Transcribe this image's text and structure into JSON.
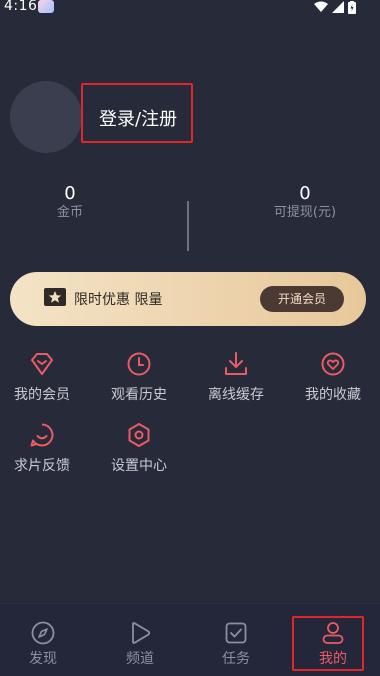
{
  "status_bar": {
    "time": "4:16"
  },
  "profile": {
    "login_label": "登录/注册"
  },
  "stats": [
    {
      "value": "0",
      "label": "金币"
    },
    {
      "value": "0",
      "label": "可提现(元)"
    }
  ],
  "vip_banner": {
    "text": "限时优惠 限量",
    "button_label": "开通会员"
  },
  "menu": {
    "items": [
      {
        "label": "我的会员",
        "icon": "diamond-icon"
      },
      {
        "label": "观看历史",
        "icon": "clock-icon"
      },
      {
        "label": "离线缓存",
        "icon": "download-icon"
      },
      {
        "label": "我的收藏",
        "icon": "heart-icon"
      },
      {
        "label": "求片反馈",
        "icon": "chat-smile-icon"
      },
      {
        "label": "设置中心",
        "icon": "settings-hex-icon"
      }
    ]
  },
  "bottom_nav": {
    "items": [
      {
        "label": "发现",
        "icon": "compass-icon"
      },
      {
        "label": "频道",
        "icon": "play-icon"
      },
      {
        "label": "任务",
        "icon": "task-check-icon"
      },
      {
        "label": "我的",
        "icon": "user-icon",
        "active": true
      }
    ]
  },
  "colors": {
    "accent": "#ea5b66",
    "background": "#272a38",
    "vip_gold": "#e7c89a"
  }
}
